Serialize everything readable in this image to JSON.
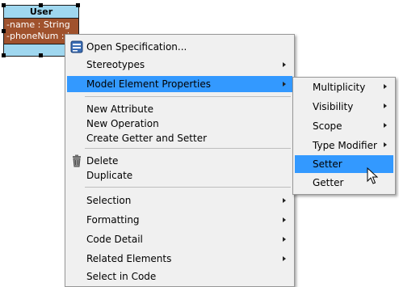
{
  "uml": {
    "title": "User",
    "attributes": [
      "-name : String",
      "-phoneNum : in"
    ],
    "colors": {
      "header": "#9fd7ef",
      "attrs_bg": "#a0522d"
    }
  },
  "context_menu": {
    "items": [
      {
        "label": "Open Specification...",
        "icon": "specification-icon"
      },
      {
        "label": "Stereotypes",
        "submenu": true
      },
      {
        "label": "Model Element Properties",
        "submenu": true,
        "highlighted": true
      },
      {
        "label": "New Attribute"
      },
      {
        "label": "New Operation"
      },
      {
        "label": "Create Getter and Setter"
      },
      {
        "label": "Delete",
        "icon": "trash-icon"
      },
      {
        "label": "Duplicate"
      },
      {
        "label": "Selection",
        "submenu": true
      },
      {
        "label": "Formatting",
        "submenu": true
      },
      {
        "label": "Code Detail",
        "submenu": true
      },
      {
        "label": "Related Elements",
        "submenu": true
      },
      {
        "label": "Select in Code"
      }
    ]
  },
  "submenu": {
    "items": [
      {
        "label": "Multiplicity",
        "submenu": true
      },
      {
        "label": "Visibility",
        "submenu": true
      },
      {
        "label": "Scope",
        "submenu": true
      },
      {
        "label": "Type Modifier",
        "submenu": true
      },
      {
        "label": "Setter",
        "highlighted": true
      },
      {
        "label": "Getter"
      }
    ]
  },
  "colors": {
    "highlight": "#3399ff",
    "menu_bg": "#f0f0f0"
  }
}
